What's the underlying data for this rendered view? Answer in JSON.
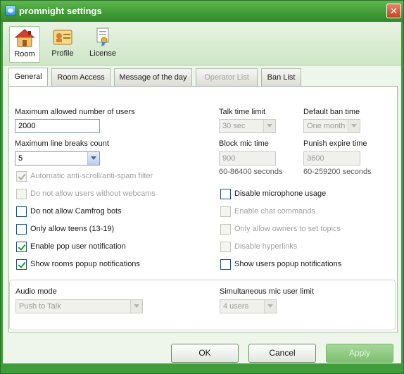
{
  "window": {
    "title": "promnight settings",
    "close_glyph": "✕"
  },
  "toolbar": {
    "items": [
      {
        "label": "Room",
        "icon": "house-icon",
        "active": true
      },
      {
        "label": "Profile",
        "icon": "profile-icon",
        "active": false
      },
      {
        "label": "License",
        "icon": "certificate-icon",
        "active": false
      }
    ]
  },
  "tabs": [
    {
      "label": "General",
      "active": true,
      "disabled": false
    },
    {
      "label": "Room Access",
      "active": false,
      "disabled": false
    },
    {
      "label": "Message of the day",
      "active": false,
      "disabled": false
    },
    {
      "label": "Operator List",
      "active": false,
      "disabled": true
    },
    {
      "label": "Ban List",
      "active": false,
      "disabled": false
    }
  ],
  "general": {
    "max_users": {
      "label": "Maximum allowed number of users",
      "value": "2000"
    },
    "max_line_breaks": {
      "label": "Maximum line breaks count",
      "value": "5"
    },
    "talk_time_limit": {
      "label": "Talk time limit",
      "value": "30 sec"
    },
    "default_ban_time": {
      "label": "Default ban time",
      "value": "One month"
    },
    "block_mic_time": {
      "label": "Block mic time",
      "value": "900",
      "hint": "60-86400 seconds"
    },
    "punish_expire_time": {
      "label": "Punish expire time",
      "value": "3600",
      "hint": "60-259200 seconds"
    },
    "checkboxes_left": [
      {
        "label": "Automatic anti-scroll/anti-spam filter",
        "checked": true,
        "enabled": false
      },
      {
        "label": "Do not allow users without webcams",
        "checked": false,
        "enabled": false
      },
      {
        "label": "Do not allow Camfrog bots",
        "checked": false,
        "enabled": true
      },
      {
        "label": "Only allow teens (13-19)",
        "checked": false,
        "enabled": true
      },
      {
        "label": "Enable pop user notification",
        "checked": true,
        "enabled": true
      },
      {
        "label": "Show rooms popup notifications",
        "checked": true,
        "enabled": true
      }
    ],
    "checkboxes_right": [
      {
        "label": "Disable microphone usage",
        "checked": false,
        "enabled": true
      },
      {
        "label": "Enable chat commands",
        "checked": false,
        "enabled": false
      },
      {
        "label": "Only allow owners to set topics",
        "checked": false,
        "enabled": false
      },
      {
        "label": "Disable hyperlinks",
        "checked": false,
        "enabled": false
      },
      {
        "label": "Show users popup notifications",
        "checked": false,
        "enabled": true
      }
    ],
    "audio_mode": {
      "label": "Audio mode",
      "value": "Push to Talk"
    },
    "mic_user_limit": {
      "label": "Simultaneous mic user limit",
      "value": "4 users"
    }
  },
  "buttons": {
    "ok": "OK",
    "cancel": "Cancel",
    "apply": "Apply"
  },
  "colors": {
    "frame": "#3e9c3a",
    "accent_check": "#21a121",
    "field_border": "#7f9db9"
  }
}
